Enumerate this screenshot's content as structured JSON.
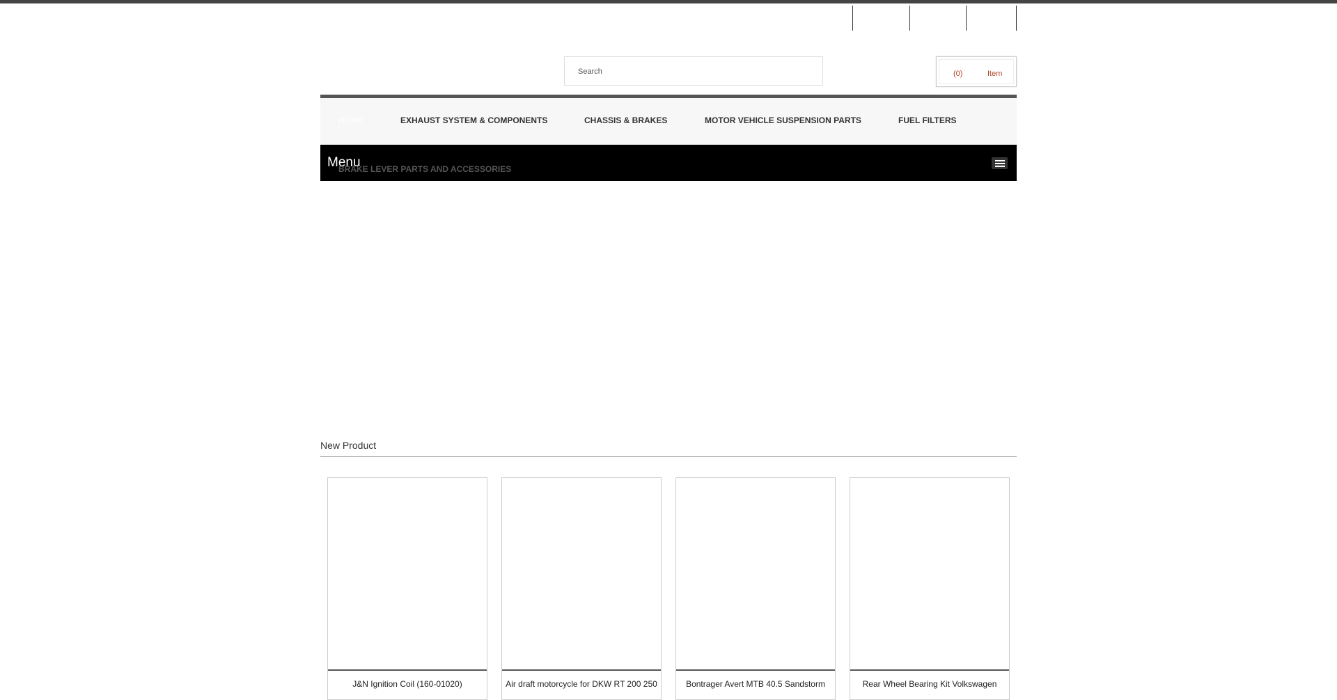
{
  "header": {
    "search": {
      "placeholder": "Search",
      "value": ""
    },
    "cart": {
      "count": "(0)",
      "label": "Item"
    }
  },
  "nav": {
    "items": [
      {
        "label": "HOME"
      },
      {
        "label": "EXHAUST SYSTEM & COMPONENTS"
      },
      {
        "label": "CHASSIS & BRAKES"
      },
      {
        "label": "MOTOR VEHICLE SUSPENSION PARTS"
      },
      {
        "label": "FUEL FILTERS"
      }
    ],
    "overflow_item": "BRAKE LEVER PARTS AND ACCESSORIES"
  },
  "mobile_menu": {
    "label": "Menu",
    "toggle_icon": "hamburger-icon"
  },
  "new_products": {
    "title": "New Product",
    "items": [
      {
        "name": "J&N Ignition Coil (160-01020)"
      },
      {
        "name": "Air draft motorcycle for DKW RT 200 250"
      },
      {
        "name": "Bontrager Avert MTB 40.5 Sandstorm"
      },
      {
        "name": "Rear Wheel Bearing Kit Volkswagen"
      }
    ]
  },
  "colors": {
    "accent": "#b0472b",
    "nav_background": "#f7f7f7",
    "menu_background": "#000000",
    "top_strip": "#444444"
  }
}
